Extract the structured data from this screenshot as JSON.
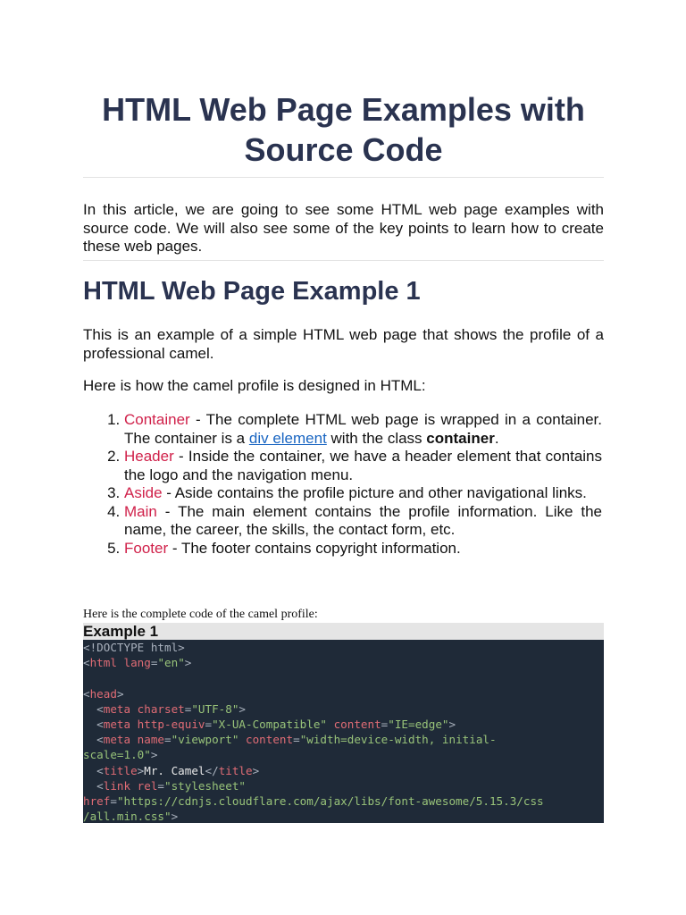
{
  "title": "HTML Web Page Examples with Source Code",
  "intro": "In this article, we are going to see some HTML web page examples with source code. We will also see some of the key points to learn how to create these web pages.",
  "heading": "HTML Web Page Example 1",
  "p1": "This is an example of a simple HTML web page that shows the profile of a professional camel.",
  "p2": "Here is how the camel profile is designed in HTML:",
  "list": [
    {
      "term": "Container",
      "text": " - The complete HTML web page is wrapped in a container. The container is a ",
      "link": "div element",
      "text2": " with the class ",
      "bold": "container",
      "text3": "."
    },
    {
      "term": "Header",
      "text": " - Inside the container, we have a header element that contains the logo and the navigation menu."
    },
    {
      "term": "Aside",
      "text": " - Aside contains the profile picture and other navigational links."
    },
    {
      "term": "Main",
      "text": " - The main element contains the profile information. Like the name, the career, the skills, the contact form, etc."
    },
    {
      "term": "Footer",
      "text": " - The footer contains copyright information."
    }
  ],
  "caption": "Here is the complete code of the camel profile:",
  "example_title": "Example 1",
  "code": [
    [
      [
        "g",
        "<!DOCTYPE html>"
      ]
    ],
    [
      [
        "g",
        "<"
      ],
      [
        "t",
        "html "
      ],
      [
        "t",
        "lang"
      ],
      [
        "g",
        "="
      ],
      [
        "s",
        "\"en\""
      ],
      [
        "g",
        ">"
      ]
    ],
    [],
    [
      [
        "g",
        "<"
      ],
      [
        "t",
        "head"
      ],
      [
        "g",
        ">"
      ]
    ],
    [
      [
        "g",
        "  <"
      ],
      [
        "t",
        "meta "
      ],
      [
        "t",
        "charset"
      ],
      [
        "g",
        "="
      ],
      [
        "s",
        "\"UTF-8\""
      ],
      [
        "g",
        ">"
      ]
    ],
    [
      [
        "g",
        "  <"
      ],
      [
        "t",
        "meta "
      ],
      [
        "t",
        "http-equiv"
      ],
      [
        "g",
        "="
      ],
      [
        "s",
        "\"X-UA-Compatible\" "
      ],
      [
        "t",
        "content"
      ],
      [
        "g",
        "="
      ],
      [
        "s",
        "\"IE=edge\""
      ],
      [
        "g",
        ">"
      ]
    ],
    [
      [
        "g",
        "  <"
      ],
      [
        "t",
        "meta "
      ],
      [
        "t",
        "name"
      ],
      [
        "g",
        "="
      ],
      [
        "s",
        "\"viewport\" "
      ],
      [
        "t",
        "content"
      ],
      [
        "g",
        "="
      ],
      [
        "s",
        "\"width=device-width, initial-"
      ]
    ],
    [
      [
        "s",
        "scale=1.0\""
      ],
      [
        "g",
        ">"
      ]
    ],
    [
      [
        "g",
        "  <"
      ],
      [
        "t",
        "title"
      ],
      [
        "g",
        ">"
      ],
      [
        "n",
        "Mr. Camel"
      ],
      [
        "g",
        "</"
      ],
      [
        "t",
        "title"
      ],
      [
        "g",
        ">"
      ]
    ],
    [
      [
        "g",
        "  <"
      ],
      [
        "t",
        "link "
      ],
      [
        "t",
        "rel"
      ],
      [
        "g",
        "="
      ],
      [
        "s",
        "\"stylesheet\""
      ]
    ],
    [
      [
        "t",
        "href"
      ],
      [
        "g",
        "="
      ],
      [
        "s",
        "\"https://cdnjs.cloudflare.com/ajax/libs/font-awesome/5.15.3/css"
      ]
    ],
    [
      [
        "s",
        "/all.min.css\""
      ],
      [
        "g",
        ">"
      ]
    ]
  ]
}
